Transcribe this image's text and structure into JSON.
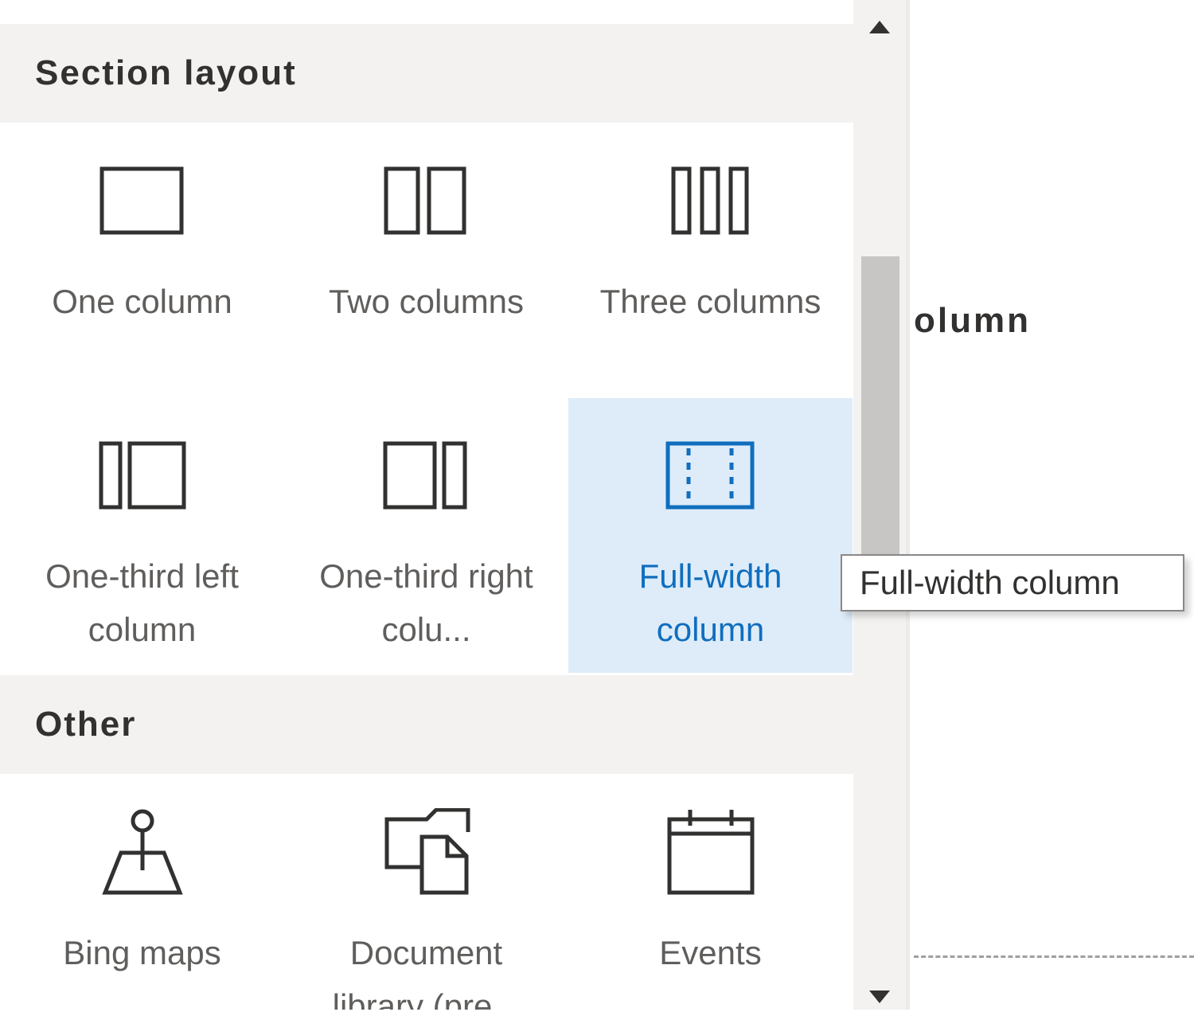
{
  "section_layout": {
    "title": "Section layout",
    "items": [
      {
        "label": "One column",
        "icon": "one-column-icon"
      },
      {
        "label": "Two columns",
        "icon": "two-columns-icon"
      },
      {
        "label": "Three columns",
        "icon": "three-columns-icon"
      },
      {
        "label": "One-third left column",
        "icon": "one-third-left-column-icon"
      },
      {
        "label": "One-third right colu...",
        "icon": "one-third-right-column-icon"
      },
      {
        "label": "Full-width column",
        "icon": "full-width-column-icon",
        "selected": true
      }
    ]
  },
  "other": {
    "title": "Other",
    "items": [
      {
        "label": "Bing maps",
        "icon": "map-pin-icon"
      },
      {
        "label": "Document library (pre...",
        "icon": "document-library-icon"
      },
      {
        "label": "Events",
        "icon": "calendar-icon"
      }
    ]
  },
  "tooltip": {
    "text": "Full-width column"
  },
  "canvas": {
    "partial_text": "olumn"
  },
  "colors": {
    "accent": "#106ebe",
    "selected_background": "#deecf9",
    "header_background": "#f3f2f1",
    "scroll_thumb": "#c8c6c4"
  }
}
